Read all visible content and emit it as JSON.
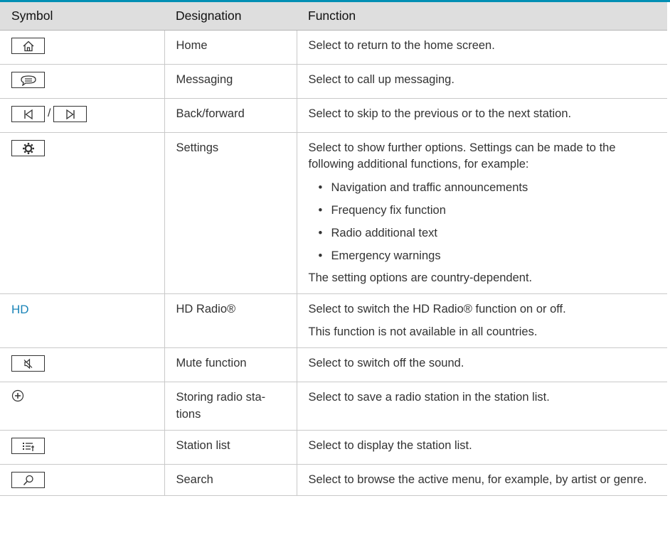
{
  "header": {
    "symbol": "Symbol",
    "designation": "Designation",
    "function": "Function"
  },
  "rows": [
    {
      "designation": "Home",
      "function": "Select to return to the home screen.",
      "icon": "home-icon"
    },
    {
      "designation": "Messaging",
      "function": "Select to call up messaging.",
      "icon": "message-icon"
    },
    {
      "designation": "Back/forward",
      "function": "Select to skip to the previous or to the next station.",
      "icon": "skip-back-forward-icons",
      "separator": "/"
    },
    {
      "designation": "Settings",
      "function": "Select to show further options. Settings can be made to the following additional functions, for example:",
      "bullets": [
        "Navigation and traffic announcements",
        "Frequency fix function",
        "Radio additional text",
        "Emergency warnings"
      ],
      "note": "The setting options are country-dependent.",
      "icon": "gear-icon"
    },
    {
      "symbol_text": "HD",
      "designation": "HD Radio®",
      "function": "Select to switch the HD Radio® function on or off.",
      "note": "This function is not available in all countries."
    },
    {
      "designation": "Mute function",
      "function": "Select to switch off the sound.",
      "icon": "mute-icon"
    },
    {
      "designation": "Storing radio sta-\ntions",
      "function": "Select to save a radio station in the station list.",
      "icon": "circle-plus-icon"
    },
    {
      "designation": "Station list",
      "function": "Select to display the station list.",
      "icon": "list-icon"
    },
    {
      "designation": "Search",
      "function": "Select to browse the active menu, for example, by artist or genre.",
      "icon": "search-icon"
    }
  ],
  "colors": {
    "accent": "#008fb4",
    "header_bg": "#dedede",
    "hd_text": "#1a84b8"
  }
}
